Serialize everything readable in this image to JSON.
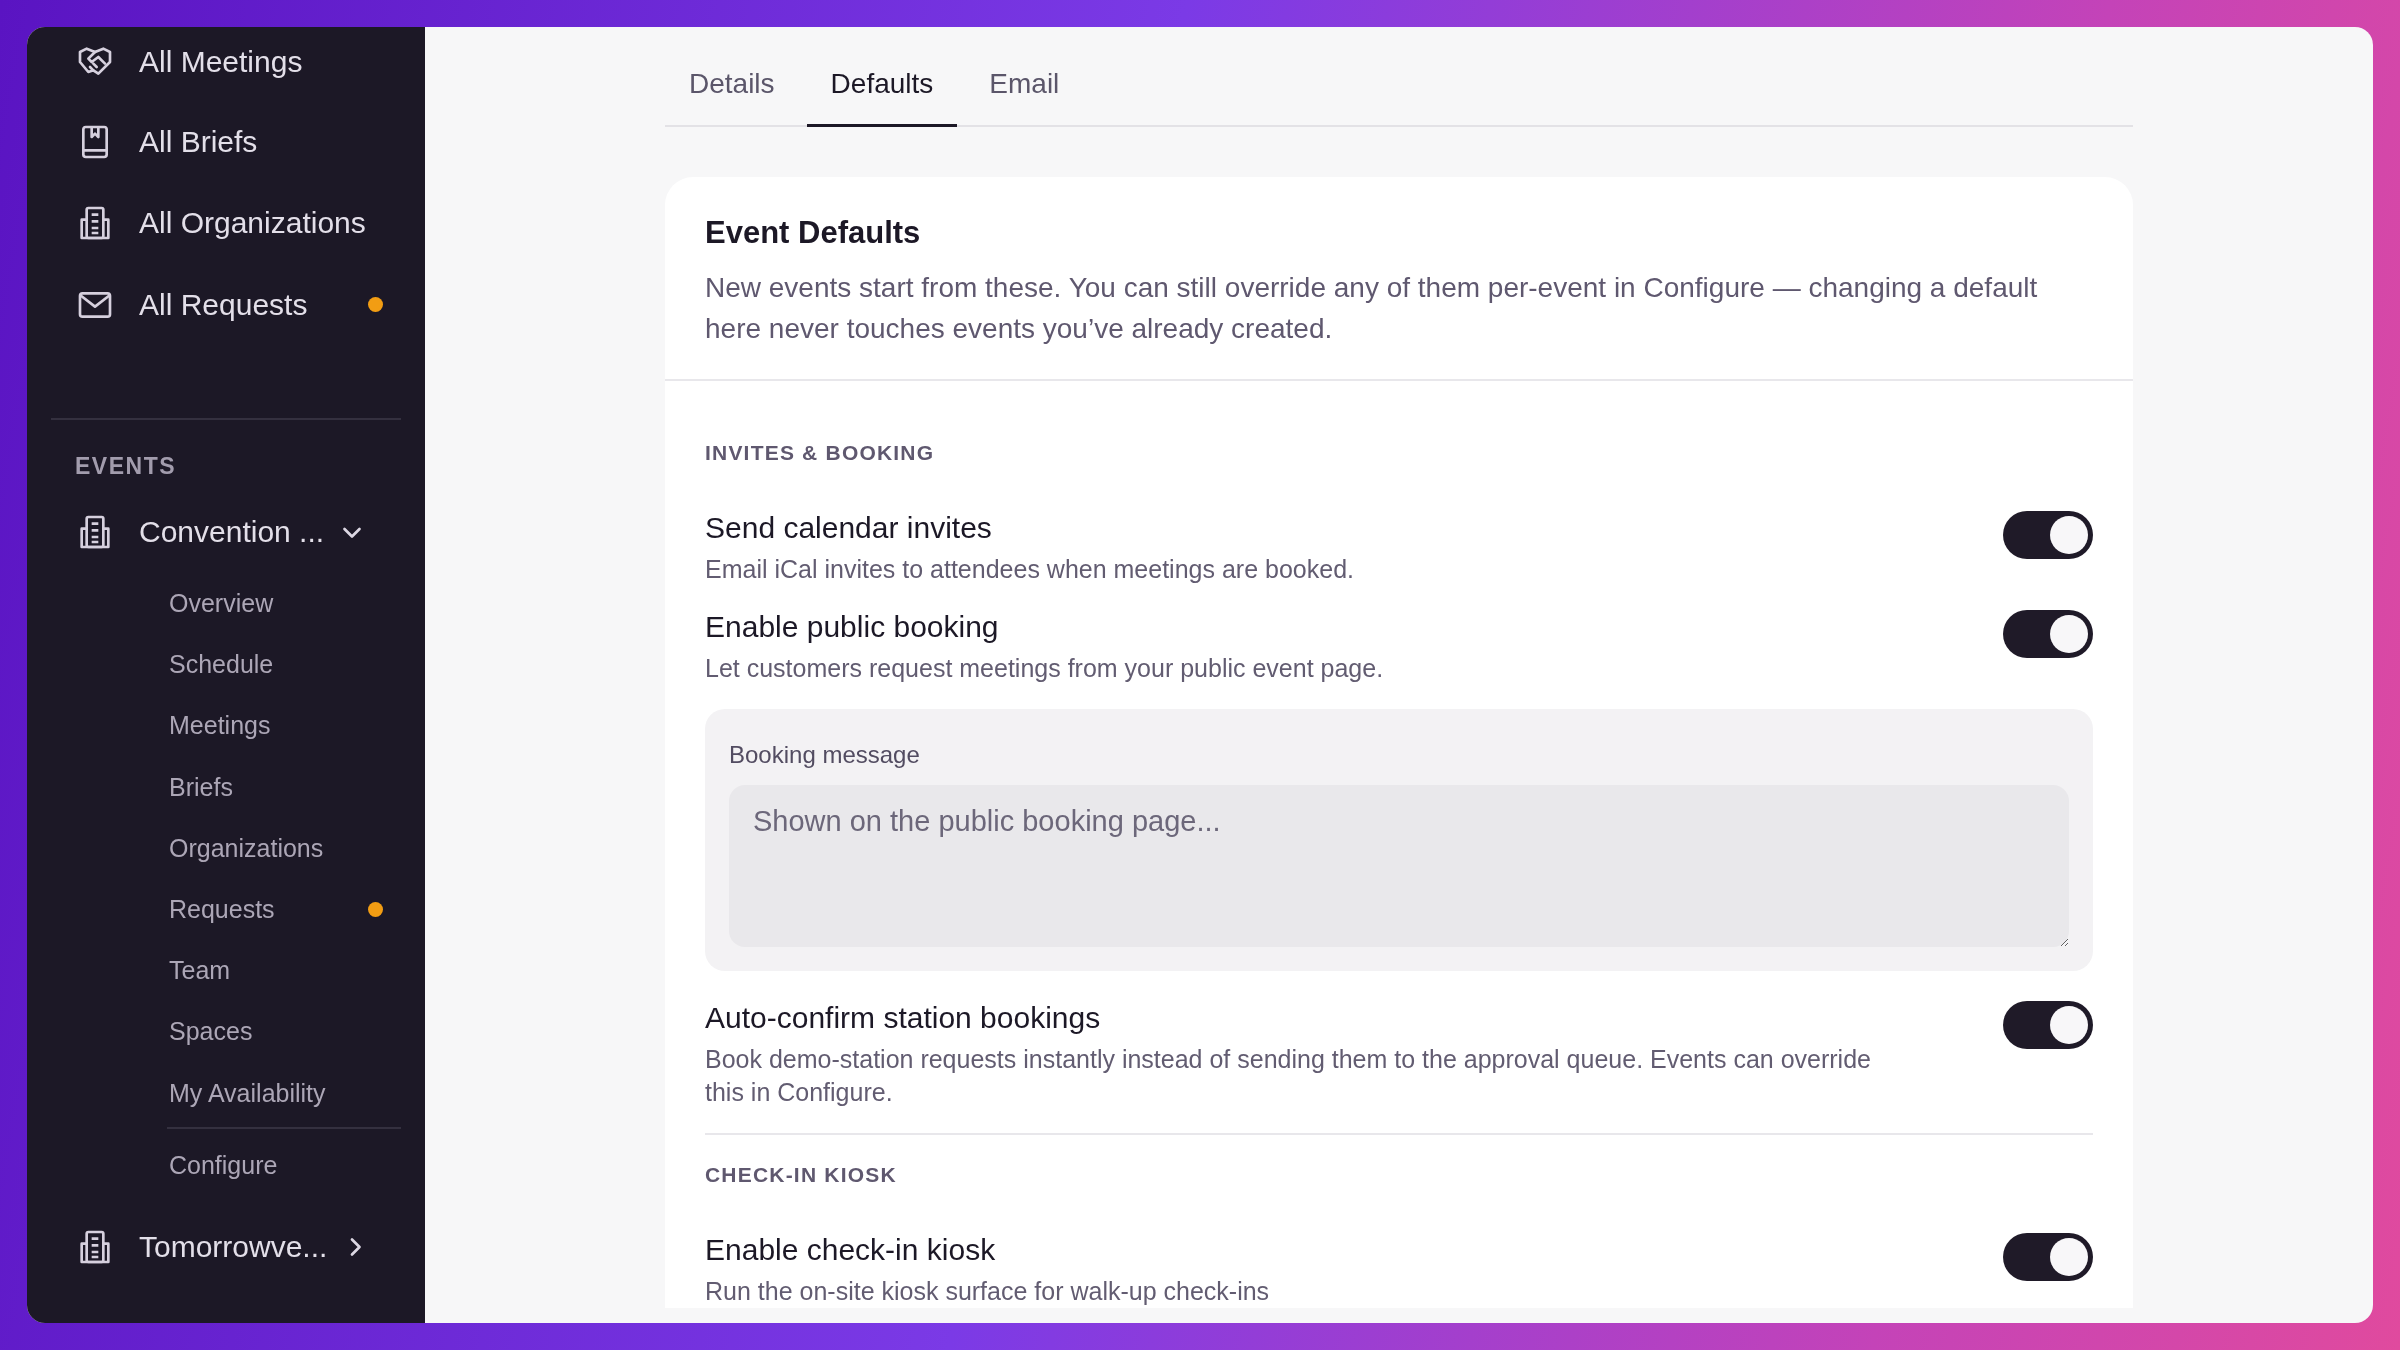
{
  "sidebar": {
    "items": [
      {
        "label": "All Meetings"
      },
      {
        "label": "All Briefs"
      },
      {
        "label": "All Organizations"
      },
      {
        "label": "All Requests",
        "color": "#f29d13"
      }
    ],
    "section_label": "EVENTS",
    "events": [
      {
        "name": "Convention ...",
        "expanded": true,
        "items": [
          {
            "label": "Overview"
          },
          {
            "label": "Schedule"
          },
          {
            "label": "Meetings"
          },
          {
            "label": "Briefs"
          },
          {
            "label": "Organizations"
          },
          {
            "label": "Requests",
            "color": "#f29d13"
          },
          {
            "label": "Team"
          },
          {
            "label": "Spaces"
          },
          {
            "label": "My Availability"
          }
        ],
        "settings_items": [
          {
            "label": "Configure"
          }
        ]
      },
      {
        "name": "Tomorrowve...",
        "expanded": false
      }
    ]
  },
  "tabs": [
    {
      "label": "Details",
      "selected": false
    },
    {
      "label": "Defaults",
      "selected": true
    },
    {
      "label": "Email",
      "selected": false
    }
  ],
  "card": {
    "title": "Event Defaults",
    "description": "New events start from these. You can still override any of them per-event in Configure — changing a default here never touches events you’ve already created.",
    "sections": [
      {
        "label": "INVITES & BOOKING",
        "divider": false,
        "rows": [
          {
            "kind": "toggle",
            "title": "Send calendar invites",
            "description": "Email iCal invites to attendees when meetings are booked.",
            "on": true
          },
          {
            "kind": "toggle",
            "title": "Enable public booking",
            "description": "Let customers request meetings from your public event page.",
            "on": true
          },
          {
            "kind": "textarea",
            "label": "Booking message",
            "placeholder": "Shown on the public booking page..."
          },
          {
            "kind": "toggle",
            "title": "Auto-confirm station bookings",
            "description": "Book demo-station requests instantly instead of sending them to the approval queue. Events can override this in Configure.",
            "on": true
          }
        ]
      },
      {
        "label": "CHECK-IN KIOSK",
        "divider": true,
        "rows": [
          {
            "kind": "toggle",
            "title": "Enable check-in kiosk",
            "description": "Run the on-site kiosk surface for walk-up check-ins",
            "on": true
          }
        ]
      }
    ]
  }
}
